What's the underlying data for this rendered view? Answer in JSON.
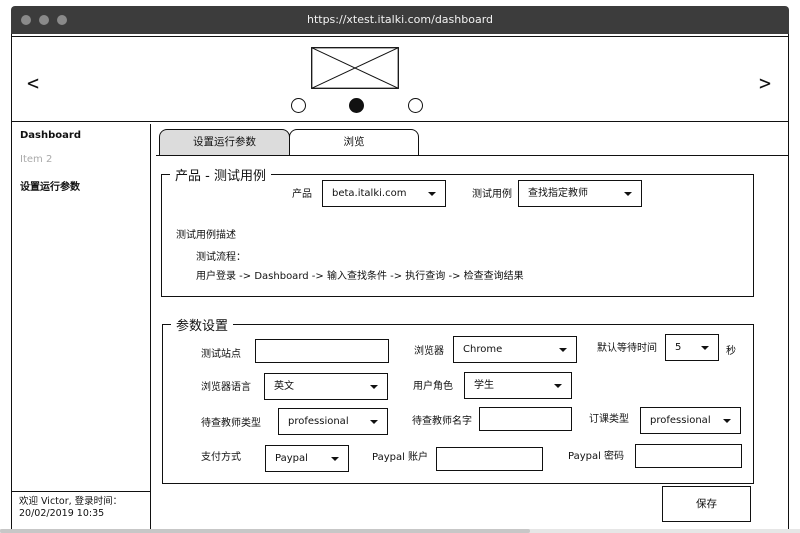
{
  "browser": {
    "url": "https://xtest.italki.com/dashboard"
  },
  "header": {
    "prev": "<",
    "next": ">"
  },
  "sidebar": {
    "items": [
      {
        "label": "Dashboard"
      },
      {
        "label": "Item 2"
      },
      {
        "label": "设置运行参数"
      }
    ],
    "footer_line1": "欢迎 Victor, 登录时间：",
    "footer_line2": "20/02/2019 10:35"
  },
  "tabs": [
    {
      "label": "设置运行参数"
    },
    {
      "label": "浏览"
    }
  ],
  "product_section": {
    "legend": "产品 - 测试用例",
    "product_label": "产品",
    "product_value": "beta.italki.com",
    "case_label": "测试用例",
    "case_value": "查找指定教师",
    "desc_title": "测试用例描述",
    "flow_label": "测试流程：",
    "flow_text": "用户登录 -> Dashboard -> 输入查找条件 -> 执行查询 -> 检查查询结果"
  },
  "params_section": {
    "legend": "参数设置",
    "site_label": "测试站点",
    "browser_label": "浏览器",
    "browser_value": "Chrome",
    "wait_label": "默认等待时间",
    "wait_value": "5",
    "wait_unit": "秒",
    "lang_label": "浏览器语言",
    "lang_value": "英文",
    "role_label": "用户角色",
    "role_value": "学生",
    "teacher_type_label": "待查教师类型",
    "teacher_type_value": "professional",
    "teacher_name_label": "待查教师名字",
    "lesson_type_label": "订课类型",
    "lesson_type_value": "professional",
    "pay_label": "支付方式",
    "pay_value": "Paypal",
    "paypal_account_label": "Paypal 账户",
    "paypal_password_label": "Paypal 密码"
  },
  "save_label": "保存"
}
